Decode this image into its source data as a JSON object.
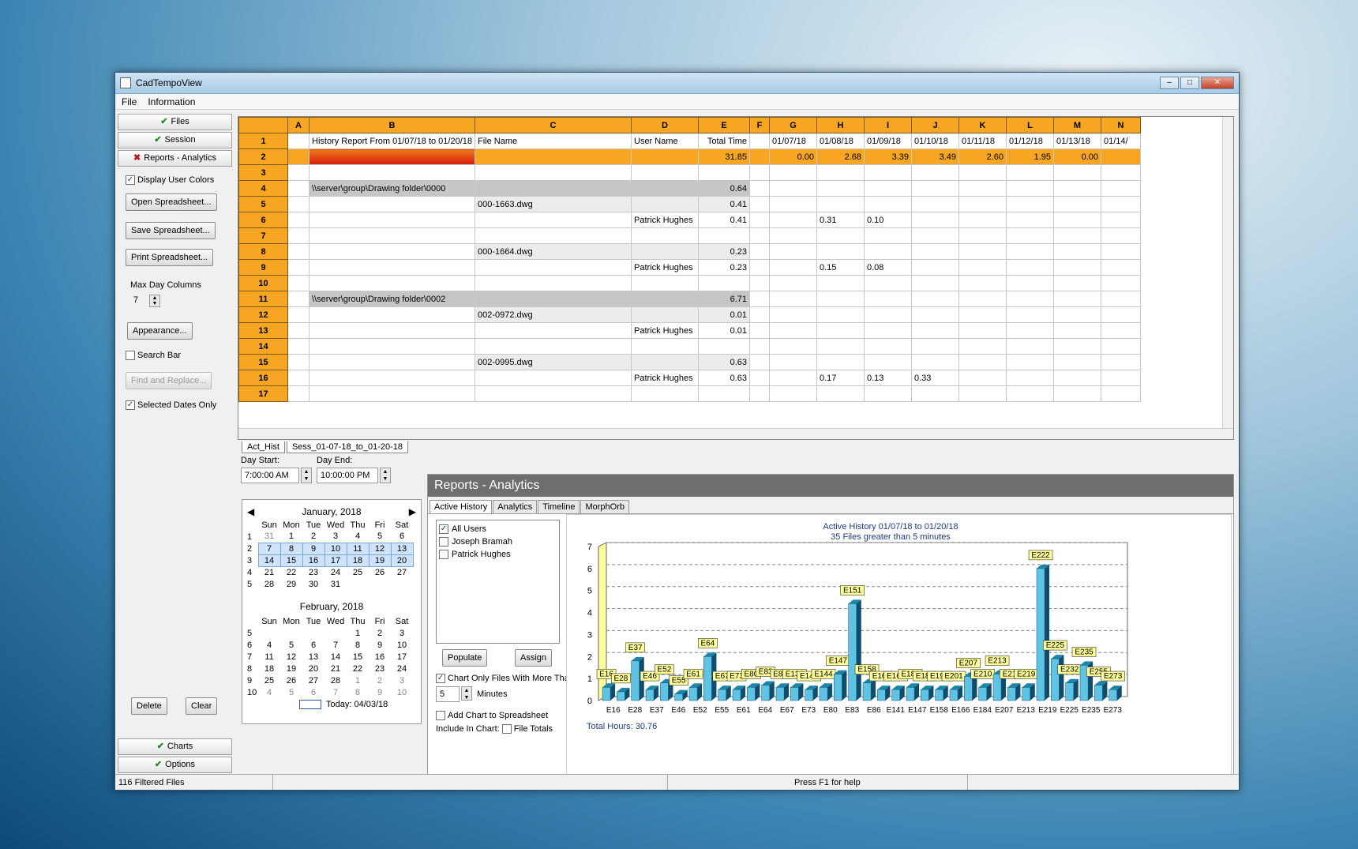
{
  "window": {
    "title": "CadTempoView"
  },
  "menu": [
    "File",
    "Information"
  ],
  "nav": {
    "files": "Files",
    "session": "Session",
    "reports": "Reports - Analytics",
    "charts": "Charts",
    "options": "Options"
  },
  "left": {
    "display_user_colors": "Display User Colors",
    "open": "Open Spreadsheet...",
    "save": "Save Spreadsheet...",
    "print": "Print Spreadsheet...",
    "max_day_columns": "Max Day Columns",
    "max_day_value": "7",
    "appearance": "Appearance...",
    "search_bar": "Search Bar",
    "find_replace": "Find and Replace...",
    "selected_dates": "Selected Dates Only",
    "delete": "Delete",
    "clear": "Clear"
  },
  "sheet": {
    "cols": [
      "A",
      "B",
      "C",
      "D",
      "E",
      "F",
      "G",
      "H",
      "I",
      "J",
      "K",
      "L",
      "M",
      "N"
    ],
    "rows": [
      [
        "1",
        "",
        "History Report From 01/07/18 to 01/20/18",
        "File Name",
        "User Name",
        "Total Time",
        "",
        "01/07/18",
        "01/08/18",
        "01/09/18",
        "01/10/18",
        "01/11/18",
        "01/12/18",
        "01/13/18",
        "01/14/"
      ],
      [
        "2",
        "",
        "",
        "",
        "",
        "31.85",
        "",
        "0.00",
        "2.68",
        "3.39",
        "3.49",
        "2.60",
        "1.95",
        "0.00",
        ""
      ],
      [
        "3",
        "",
        "",
        "",
        "",
        "",
        "",
        "",
        "",
        "",
        "",
        "",
        "",
        "",
        ""
      ],
      [
        "4",
        "",
        "\\\\server\\group\\Drawing folder\\0000",
        "",
        "",
        "0.64",
        "",
        "",
        "",
        "",
        "",
        "",
        "",
        "",
        ""
      ],
      [
        "5",
        "",
        "",
        "000-1663.dwg",
        "",
        "0.41",
        "",
        "",
        "",
        "",
        "",
        "",
        "",
        "",
        ""
      ],
      [
        "6",
        "",
        "",
        "",
        "Patrick Hughes",
        "0.41",
        "",
        "",
        "0.31",
        "0.10",
        "",
        "",
        "",
        "",
        ""
      ],
      [
        "7",
        "",
        "",
        "",
        "",
        "",
        "",
        "",
        "",
        "",
        "",
        "",
        "",
        "",
        ""
      ],
      [
        "8",
        "",
        "",
        "000-1664.dwg",
        "",
        "0.23",
        "",
        "",
        "",
        "",
        "",
        "",
        "",
        "",
        ""
      ],
      [
        "9",
        "",
        "",
        "",
        "Patrick Hughes",
        "0.23",
        "",
        "",
        "0.15",
        "0.08",
        "",
        "",
        "",
        "",
        ""
      ],
      [
        "10",
        "",
        "",
        "",
        "",
        "",
        "",
        "",
        "",
        "",
        "",
        "",
        "",
        "",
        ""
      ],
      [
        "11",
        "",
        "\\\\server\\group\\Drawing folder\\0002",
        "",
        "",
        "6.71",
        "",
        "",
        "",
        "",
        "",
        "",
        "",
        "",
        ""
      ],
      [
        "12",
        "",
        "",
        "002-0972.dwg",
        "",
        "0.01",
        "",
        "",
        "",
        "",
        "",
        "",
        "",
        "",
        ""
      ],
      [
        "13",
        "",
        "",
        "",
        "Patrick Hughes",
        "0.01",
        "",
        "",
        "",
        "",
        "",
        "",
        "",
        "",
        ""
      ],
      [
        "14",
        "",
        "",
        "",
        "",
        "",
        "",
        "",
        "",
        "",
        "",
        "",
        "",
        "",
        ""
      ],
      [
        "15",
        "",
        "",
        "002-0995.dwg",
        "",
        "0.63",
        "",
        "",
        "",
        "",
        "",
        "",
        "",
        "",
        ""
      ],
      [
        "16",
        "",
        "",
        "",
        "Patrick Hughes",
        "0.63",
        "",
        "",
        "0.17",
        "0.13",
        "0.33",
        "",
        "",
        "",
        ""
      ],
      [
        "17",
        "",
        "",
        "",
        "",
        "",
        "",
        "",
        "",
        "",
        "",
        "",
        "",
        "",
        ""
      ]
    ],
    "tabs": [
      "Act_Hist",
      "Sess_01-07-18_to_01-20-18"
    ]
  },
  "time": {
    "day_start_label": "Day Start:",
    "day_end_label": "Day End:",
    "day_start": "7:00:00 AM",
    "day_end": "10:00:00 PM"
  },
  "calendar": {
    "dow": [
      "Sun",
      "Mon",
      "Tue",
      "Wed",
      "Thu",
      "Fri",
      "Sat"
    ],
    "jan_title": "January, 2018",
    "jan": [
      [
        "1",
        "31",
        "1",
        "2",
        "3",
        "4",
        "5",
        "6"
      ],
      [
        "2",
        "7",
        "8",
        "9",
        "10",
        "11",
        "12",
        "13"
      ],
      [
        "3",
        "14",
        "15",
        "16",
        "17",
        "18",
        "19",
        "20"
      ],
      [
        "4",
        "21",
        "22",
        "23",
        "24",
        "25",
        "26",
        "27"
      ],
      [
        "5",
        "28",
        "29",
        "30",
        "31",
        "",
        "",
        ""
      ]
    ],
    "feb_title": "February, 2018",
    "feb": [
      [
        "5",
        "",
        "",
        "",
        "",
        "1",
        "2",
        "3"
      ],
      [
        "6",
        "4",
        "5",
        "6",
        "7",
        "8",
        "9",
        "10"
      ],
      [
        "7",
        "11",
        "12",
        "13",
        "14",
        "15",
        "16",
        "17"
      ],
      [
        "8",
        "18",
        "19",
        "20",
        "21",
        "22",
        "23",
        "24"
      ],
      [
        "9",
        "25",
        "26",
        "27",
        "28",
        "1",
        "2",
        "3"
      ],
      [
        "10",
        "4",
        "5",
        "6",
        "7",
        "8",
        "9",
        "10"
      ]
    ],
    "today": "Today: 04/03/18"
  },
  "reports": {
    "title": "Reports - Analytics",
    "tabs": [
      "Active History",
      "Analytics",
      "Timeline",
      "MorphOrb"
    ],
    "users": [
      "All Users",
      "Joseph Bramah",
      "Patrick Hughes"
    ],
    "populate": "Populate",
    "assign": "Assign",
    "chart_only": "Chart Only Files With More Than",
    "minutes_value": "5",
    "minutes": "Minutes",
    "add_chart": "Add Chart to Spreadsheet",
    "include": "Include In Chart:",
    "file_totals": "File Totals"
  },
  "chart_data": {
    "type": "bar",
    "title": "Active History 01/07/18 to 01/20/18",
    "subtitle": "35 Files greater than 5 minutes",
    "ylim": [
      0,
      7
    ],
    "yticks": [
      "0",
      "1",
      "2",
      "3",
      "4",
      "5",
      "6",
      "7"
    ],
    "categories": [
      "E16",
      "E28",
      "E37",
      "E46",
      "E52",
      "E55",
      "E61",
      "E64",
      "E67",
      "E73",
      "E80",
      "E83",
      "E86",
      "E136",
      "E141",
      "E144",
      "E147",
      "E151",
      "E158",
      "E161",
      "E166",
      "E181",
      "E184",
      "E193",
      "E201",
      "E207",
      "E210",
      "E213",
      "E215",
      "E219",
      "E222",
      "E225",
      "E232",
      "E235",
      "E255",
      "E273"
    ],
    "xticks": [
      "E16",
      "E28",
      "E37",
      "E46",
      "E52",
      "E55",
      "E61",
      "E64",
      "E67",
      "E73",
      "E80",
      "E83",
      "E86",
      "E141",
      "E147",
      "E158",
      "E166",
      "E184",
      "E207",
      "E213",
      "E219",
      "E225",
      "E235",
      "E273"
    ],
    "values": [
      0.6,
      0.4,
      1.8,
      0.5,
      0.8,
      0.3,
      0.6,
      2.0,
      0.5,
      0.5,
      0.6,
      0.7,
      0.6,
      0.6,
      0.5,
      0.6,
      1.2,
      4.4,
      0.8,
      0.5,
      0.5,
      0.6,
      0.5,
      0.5,
      0.5,
      1.1,
      0.6,
      1.2,
      0.6,
      0.6,
      6.0,
      1.9,
      0.8,
      1.6,
      0.7,
      0.5
    ],
    "labels": [
      "E16",
      "E28",
      "E37",
      "E46",
      "E52",
      "E55",
      "E61",
      "E64",
      "E67",
      "E73",
      "E80",
      "E83",
      "E86",
      "E136",
      "E141",
      "E144",
      "E147",
      "E151",
      "E158",
      "E161",
      "E166",
      "E181",
      "E184",
      "E193",
      "E201",
      "E207",
      "E210",
      "E213",
      "E215",
      "E219",
      "E222",
      "E225",
      "E232",
      "E235",
      "E255",
      "E273"
    ],
    "total": "Total Hours: 30.76"
  },
  "status": {
    "files": "116 Filtered Files",
    "help": "Press F1 for help"
  }
}
